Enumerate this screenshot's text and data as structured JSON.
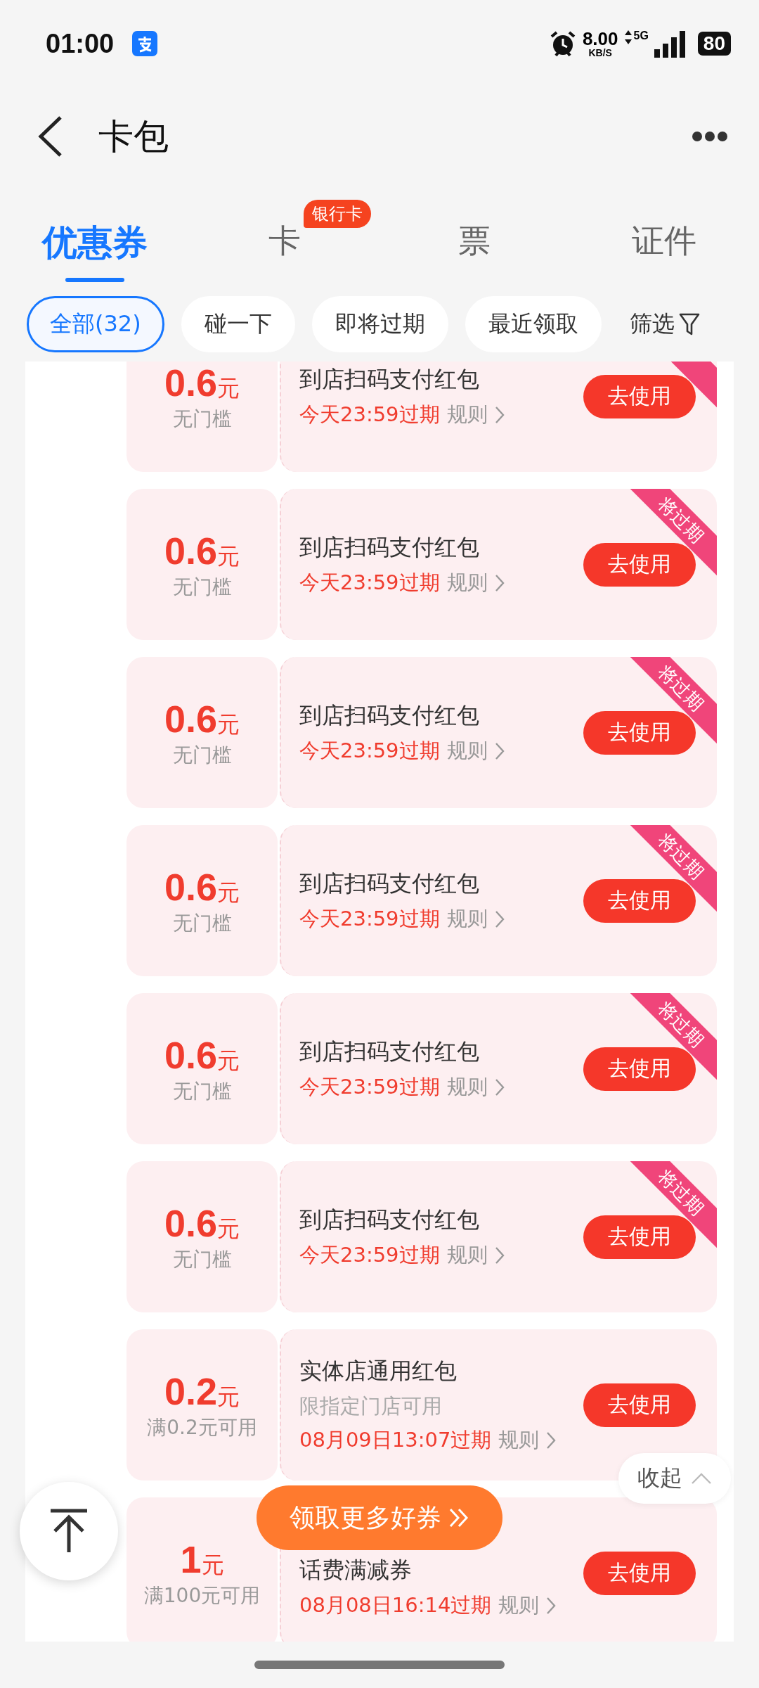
{
  "status_bar": {
    "time": "01:00",
    "speed": "8.00",
    "speed_unit": "KB/S",
    "network": "5G",
    "battery": "80"
  },
  "header": {
    "title": "卡包"
  },
  "tabs": [
    {
      "label": "优惠券",
      "selected": true
    },
    {
      "label": "卡",
      "selected": false,
      "badge": "银行卡"
    },
    {
      "label": "票",
      "selected": false
    },
    {
      "label": "证件",
      "selected": false
    }
  ],
  "filters": [
    {
      "label": "全部(32)",
      "selected": true
    },
    {
      "label": "碰一下",
      "selected": false
    },
    {
      "label": "即将过期",
      "selected": false
    },
    {
      "label": "最近领取",
      "selected": false
    }
  ],
  "filter_button": {
    "label": "筛选"
  },
  "coupons": [
    {
      "amount": "0.6",
      "unit": "元",
      "condition": "无门槛",
      "title": "到店扫码支付红包",
      "expiry": "今天23:59过期",
      "rules": "规则",
      "action": "去使用",
      "expiring": true
    },
    {
      "amount": "0.6",
      "unit": "元",
      "condition": "无门槛",
      "title": "到店扫码支付红包",
      "expiry": "今天23:59过期",
      "rules": "规则",
      "action": "去使用",
      "expiring": true,
      "ribbon": "将过期"
    },
    {
      "amount": "0.6",
      "unit": "元",
      "condition": "无门槛",
      "title": "到店扫码支付红包",
      "expiry": "今天23:59过期",
      "rules": "规则",
      "action": "去使用",
      "expiring": true,
      "ribbon": "将过期"
    },
    {
      "amount": "0.6",
      "unit": "元",
      "condition": "无门槛",
      "title": "到店扫码支付红包",
      "expiry": "今天23:59过期",
      "rules": "规则",
      "action": "去使用",
      "expiring": true,
      "ribbon": "将过期"
    },
    {
      "amount": "0.6",
      "unit": "元",
      "condition": "无门槛",
      "title": "到店扫码支付红包",
      "expiry": "今天23:59过期",
      "rules": "规则",
      "action": "去使用",
      "expiring": true,
      "ribbon": "将过期"
    },
    {
      "amount": "0.6",
      "unit": "元",
      "condition": "无门槛",
      "title": "到店扫码支付红包",
      "expiry": "今天23:59过期",
      "rules": "规则",
      "action": "去使用",
      "expiring": true,
      "ribbon": "将过期"
    },
    {
      "amount": "0.2",
      "unit": "元",
      "condition": "满0.2元可用",
      "title": "实体店通用红包",
      "note": "限指定门店可用",
      "expiry": "08月09日13:07过期",
      "rules": "规则",
      "action": "去使用",
      "expiring": false
    },
    {
      "amount": "1",
      "unit": "元",
      "condition": "满100元可用",
      "title": "话费满减券",
      "expiry": "08月08日16:14过期",
      "rules": "规则",
      "action": "去使用",
      "expiring": false
    }
  ],
  "collapse": {
    "label": "收起"
  },
  "more_coupons": {
    "label": "领取更多好券"
  }
}
